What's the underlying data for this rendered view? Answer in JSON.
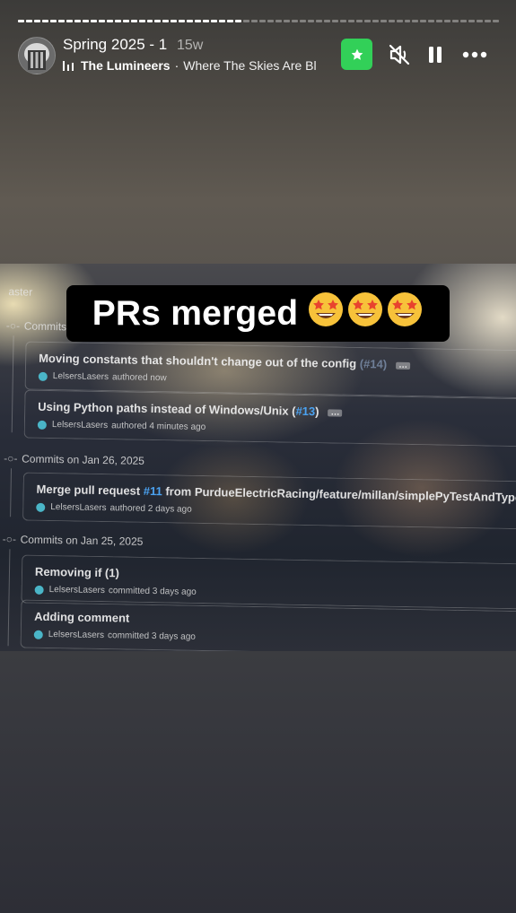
{
  "progress": {
    "total_segments": 60,
    "completed_segments": 28
  },
  "header": {
    "title": "Spring 2025 - 1",
    "time_ago": "15w",
    "music": {
      "artist": "The Lumineers",
      "separator": "·",
      "song": "Where The Skies Are Bl"
    }
  },
  "controls": {
    "star_icon": "star-icon",
    "mute_icon": "speaker-muted-icon",
    "pause_icon": "pause-icon",
    "more_icon": "more-icon",
    "accent": "#32d058"
  },
  "sticker": {
    "text": "PRs merged",
    "emoji_count": 3,
    "emoji": "star-struck-emoji"
  },
  "photo": {
    "branch_label": "aster",
    "groups": [
      {
        "header": "Commits",
        "commits": [
          {
            "msg_pre": "Moving constants that shouldn't change out of the config ",
            "pr": "(#14)",
            "msg_post": "",
            "user": "LelsersLasers",
            "action": "authored now"
          },
          {
            "msg_pre": "Using Python paths instead of Windows/Unix (",
            "pr": "#13",
            "msg_post": ")",
            "user": "LelsersLasers",
            "action": "authored 4 minutes ago"
          }
        ]
      },
      {
        "header": "Commits on Jan 26, 2025",
        "commits": [
          {
            "msg_pre": "Merge pull request ",
            "pr": "#11",
            "msg_post": " from PurdueElectricRacing/feature/millan/simplePyTestAndType",
            "user": "LelsersLasers",
            "action": "authored 2 days ago"
          }
        ]
      },
      {
        "header": "Commits on Jan 25, 2025",
        "commits": [
          {
            "msg_pre": "Removing if (1)",
            "pr": "",
            "msg_post": "",
            "user": "LelsersLasers",
            "action": "committed 3 days ago"
          },
          {
            "msg_pre": "Adding comment",
            "pr": "",
            "msg_post": "",
            "user": "LelsersLasers",
            "action": "committed 3 days ago"
          }
        ]
      }
    ]
  }
}
